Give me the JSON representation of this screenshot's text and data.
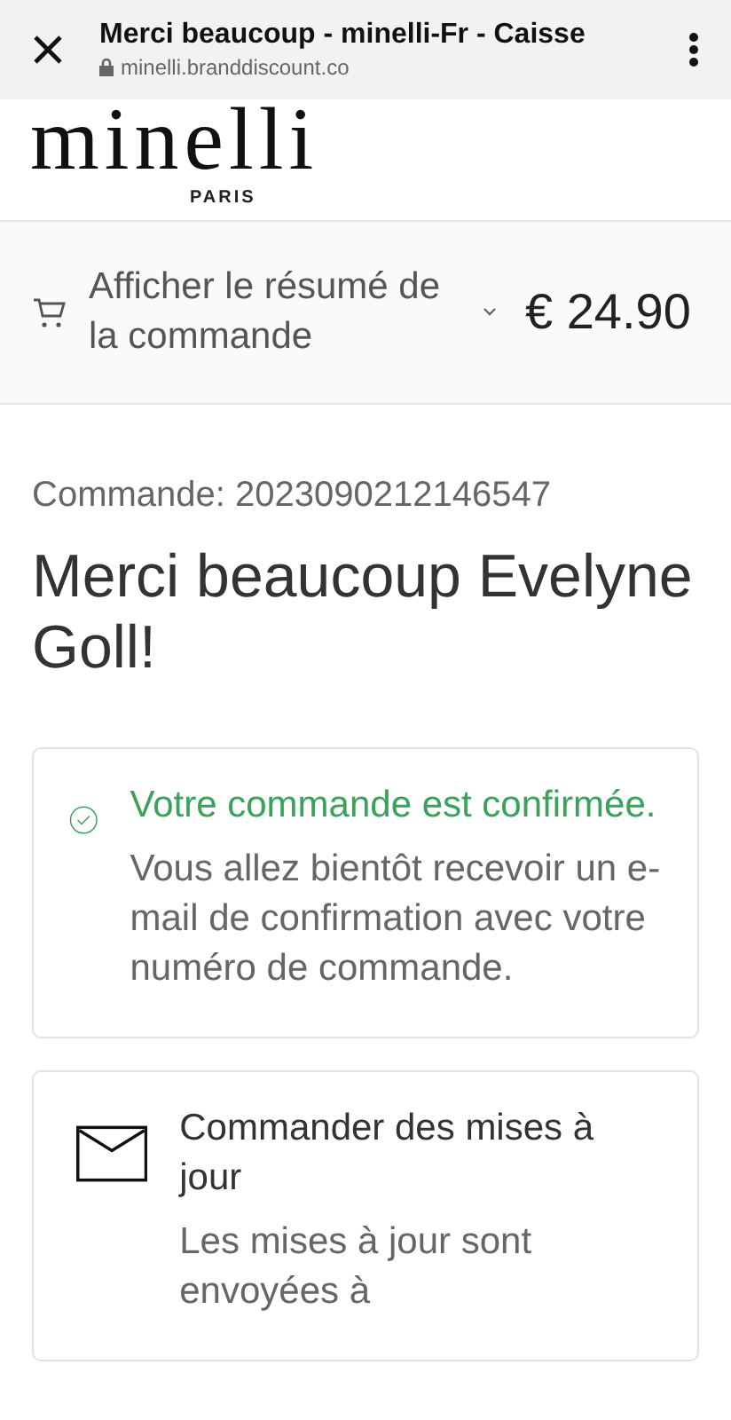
{
  "browser_bar": {
    "title": "Merci beaucoup - minelli-Fr - Caisse",
    "url": "minelli.branddiscount.co"
  },
  "logo": {
    "name": "minelli",
    "tagline": "PARIS"
  },
  "order_summary": {
    "label": "Afficher le résumé de la commande",
    "expanded": false,
    "total": "€ 24.90"
  },
  "order_number": "Commande: 2023090212146547",
  "heading": "Merci beaucoup Evelyne Goll!",
  "cards": [
    {
      "kind": "confirmed",
      "title": "Votre commande est confirmée.",
      "text": "Vous allez bientôt recevoir un e-mail de confirmation avec votre numéro de commande."
    },
    {
      "kind": "updates",
      "title": "Commander des mises à jour",
      "text": "Les mises à jour sont envoyées à"
    }
  ]
}
